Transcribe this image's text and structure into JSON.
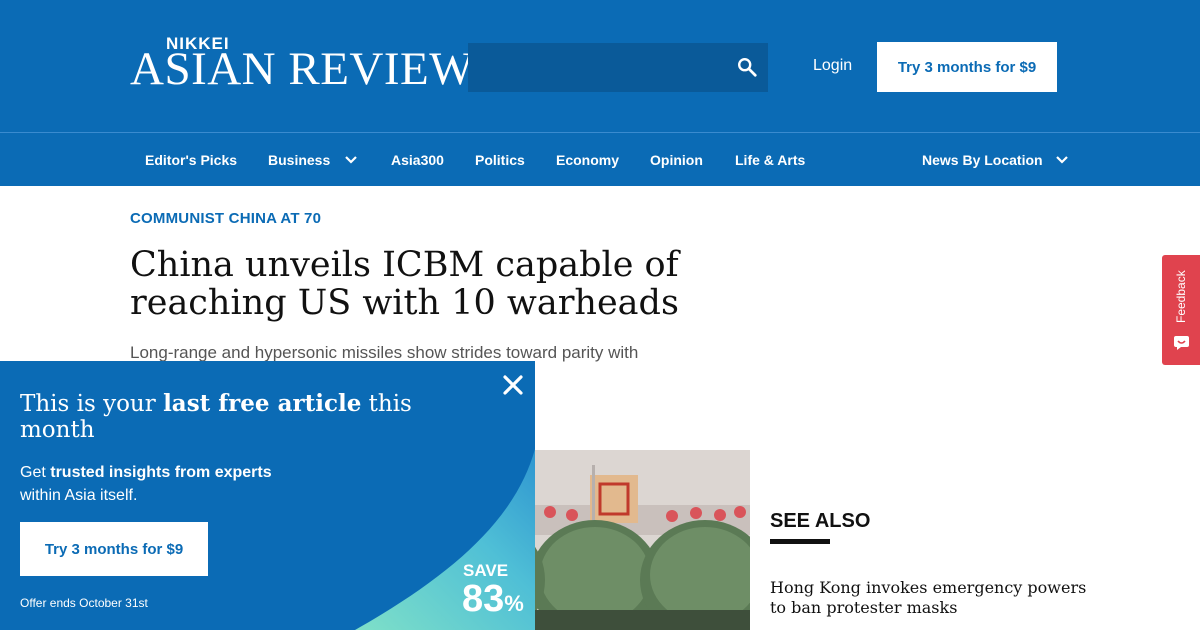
{
  "header": {
    "logo_small": "NIKKEI",
    "logo_big": "ASIAN REVIEW",
    "search_placeholder": "",
    "login_label": "Login",
    "cta_label": "Try 3 months for $9"
  },
  "nav": {
    "items": [
      {
        "label": "Editor's Picks"
      },
      {
        "label": "Business"
      },
      {
        "label": "Asia300"
      },
      {
        "label": "Politics"
      },
      {
        "label": "Economy"
      },
      {
        "label": "Opinion"
      },
      {
        "label": "Life & Arts"
      },
      {
        "label": "News By Location"
      }
    ]
  },
  "article": {
    "kicker": "COMMUNIST CHINA AT 70",
    "headline_line1": "China unveils ICBM capable of",
    "headline_line2": "reaching US with 10 warheads",
    "subhead": "Long-range and hypersonic missiles show strides toward parity with"
  },
  "see_also": {
    "title": "SEE ALSO",
    "link_line1": "Hong Kong invokes emergency powers",
    "link_line2": "to ban protester masks"
  },
  "feedback": {
    "label": "Feedback"
  },
  "paywall": {
    "title_pre": "This is your ",
    "title_bold": "last free article",
    "title_post": " this month",
    "body_pre": "Get ",
    "body_bold": "trusted insights from experts",
    "body_post": "within Asia itself.",
    "cta_label": "Try 3 months for $9",
    "offer": "Offer ends October 31st",
    "save_label": "SAVE",
    "save_value": "83",
    "save_unit": "%"
  },
  "colors": {
    "brand_blue": "#0b6bb5",
    "feedback_red": "#e0434e",
    "wave_teal": "#5fd3c4"
  }
}
